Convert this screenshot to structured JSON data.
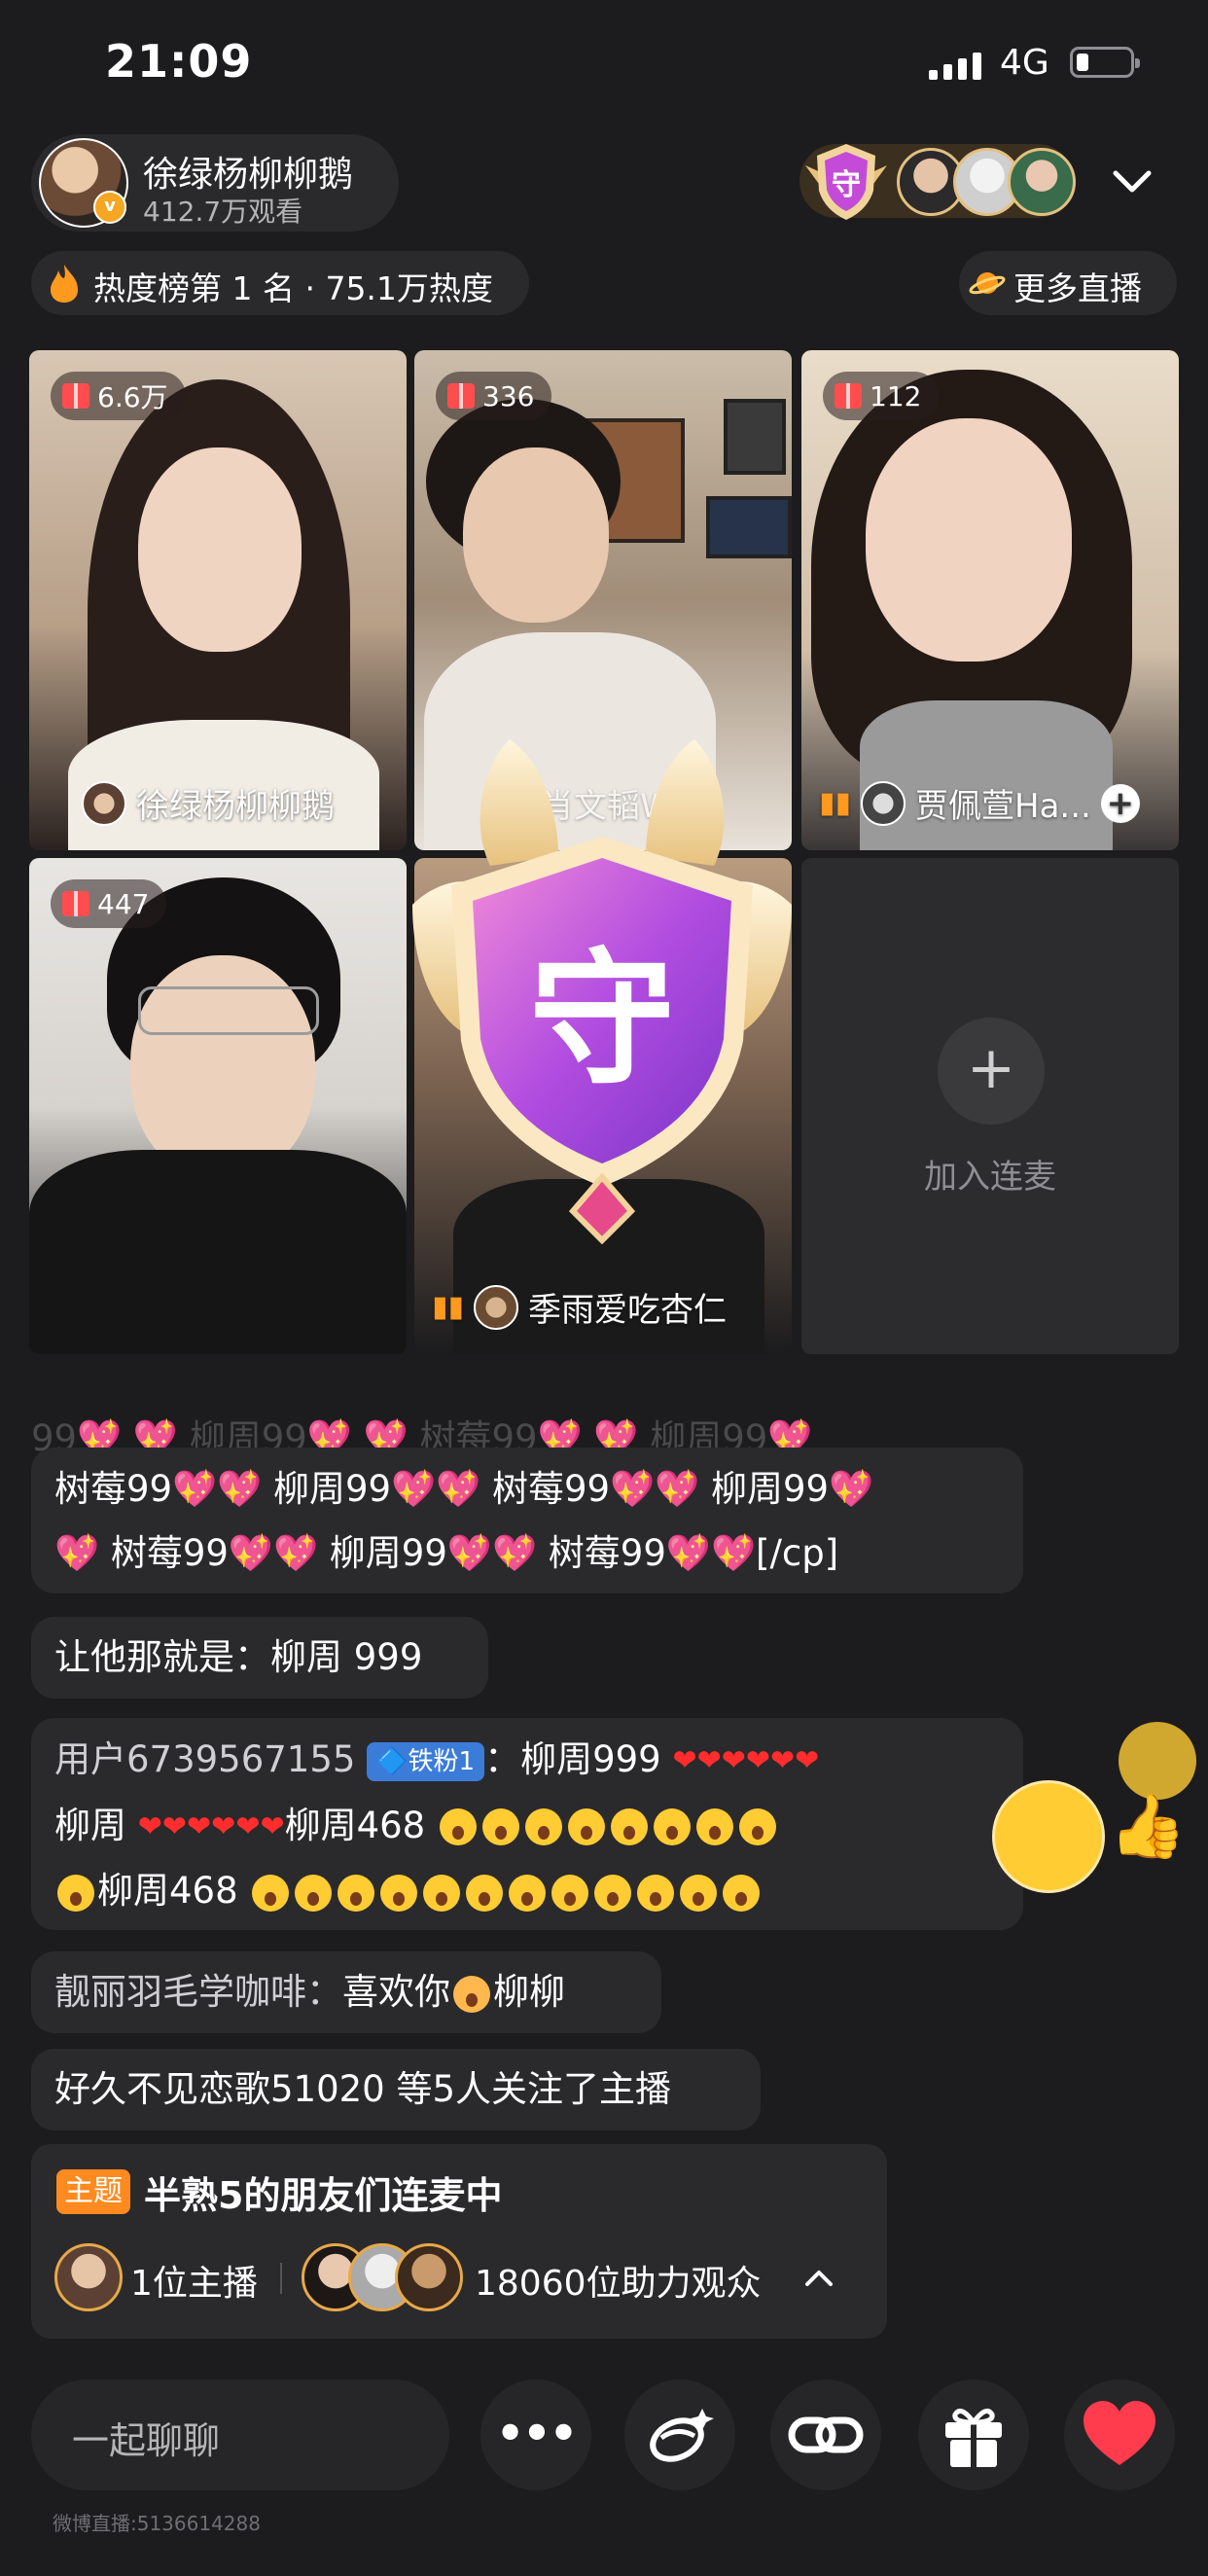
{
  "status_bar": {
    "time": "21:09",
    "network": "4G"
  },
  "host": {
    "name": "徐绿杨柳柳鹅",
    "views": "412.7万观看"
  },
  "heat": {
    "text": "热度榜第 1 名 · 75.1万热度",
    "more_live": "更多直播"
  },
  "tiles": [
    {
      "gifts": "6.6万",
      "name": "徐绿杨柳柳鹅"
    },
    {
      "gifts": "336",
      "name": "肖文韬W"
    },
    {
      "gifts": "112",
      "name": "贾佩萱Ha..."
    },
    {
      "gifts": "447",
      "name": ""
    },
    {
      "gifts": "",
      "name": "季雨爱吃杏仁"
    }
  ],
  "join": {
    "label": "加入连麦"
  },
  "guard": {
    "badge_text": "守"
  },
  "chat": {
    "faded_line": "99💖 💖 柳周99💖 💖 树莓99💖 💖 柳周99💖",
    "msg1_line1": "树莓99💖💖 柳周99💖💖 树莓99💖💖 柳周99💖",
    "msg1_line2": "💖 树莓99💖💖 柳周99💖💖 树莓99💖💖[/cp]",
    "msg2": "让他那就是：柳周 999",
    "msg3_user": "用户6739567155",
    "msg3_badge": "🔷铁粉1",
    "msg3_line1_text": "：柳周999",
    "msg3_line2_a": "柳周",
    "msg3_line2_b": "柳周468",
    "msg3_line3": "柳周468",
    "msg4_user": "靓丽羽毛学咖啡：",
    "msg4_text_a": "喜欢你",
    "msg4_text_b": "柳柳",
    "msg5": "好久不见恋歌51020 等5人关注了主播"
  },
  "topic": {
    "tag": "主题",
    "title": "半熟5的朋友们连麦中",
    "hosts": "1位主播",
    "audience": "18060位助力观众"
  },
  "bottom": {
    "input_placeholder": "一起聊聊",
    "more": "•••"
  },
  "footer": {
    "watermark": "微博直播:5136614288"
  },
  "colors": {
    "background": "#1c1c1e",
    "accent_orange": "#ff8a1f",
    "heart_red": "#ff3b4e",
    "pink": "#ff5fa2"
  }
}
